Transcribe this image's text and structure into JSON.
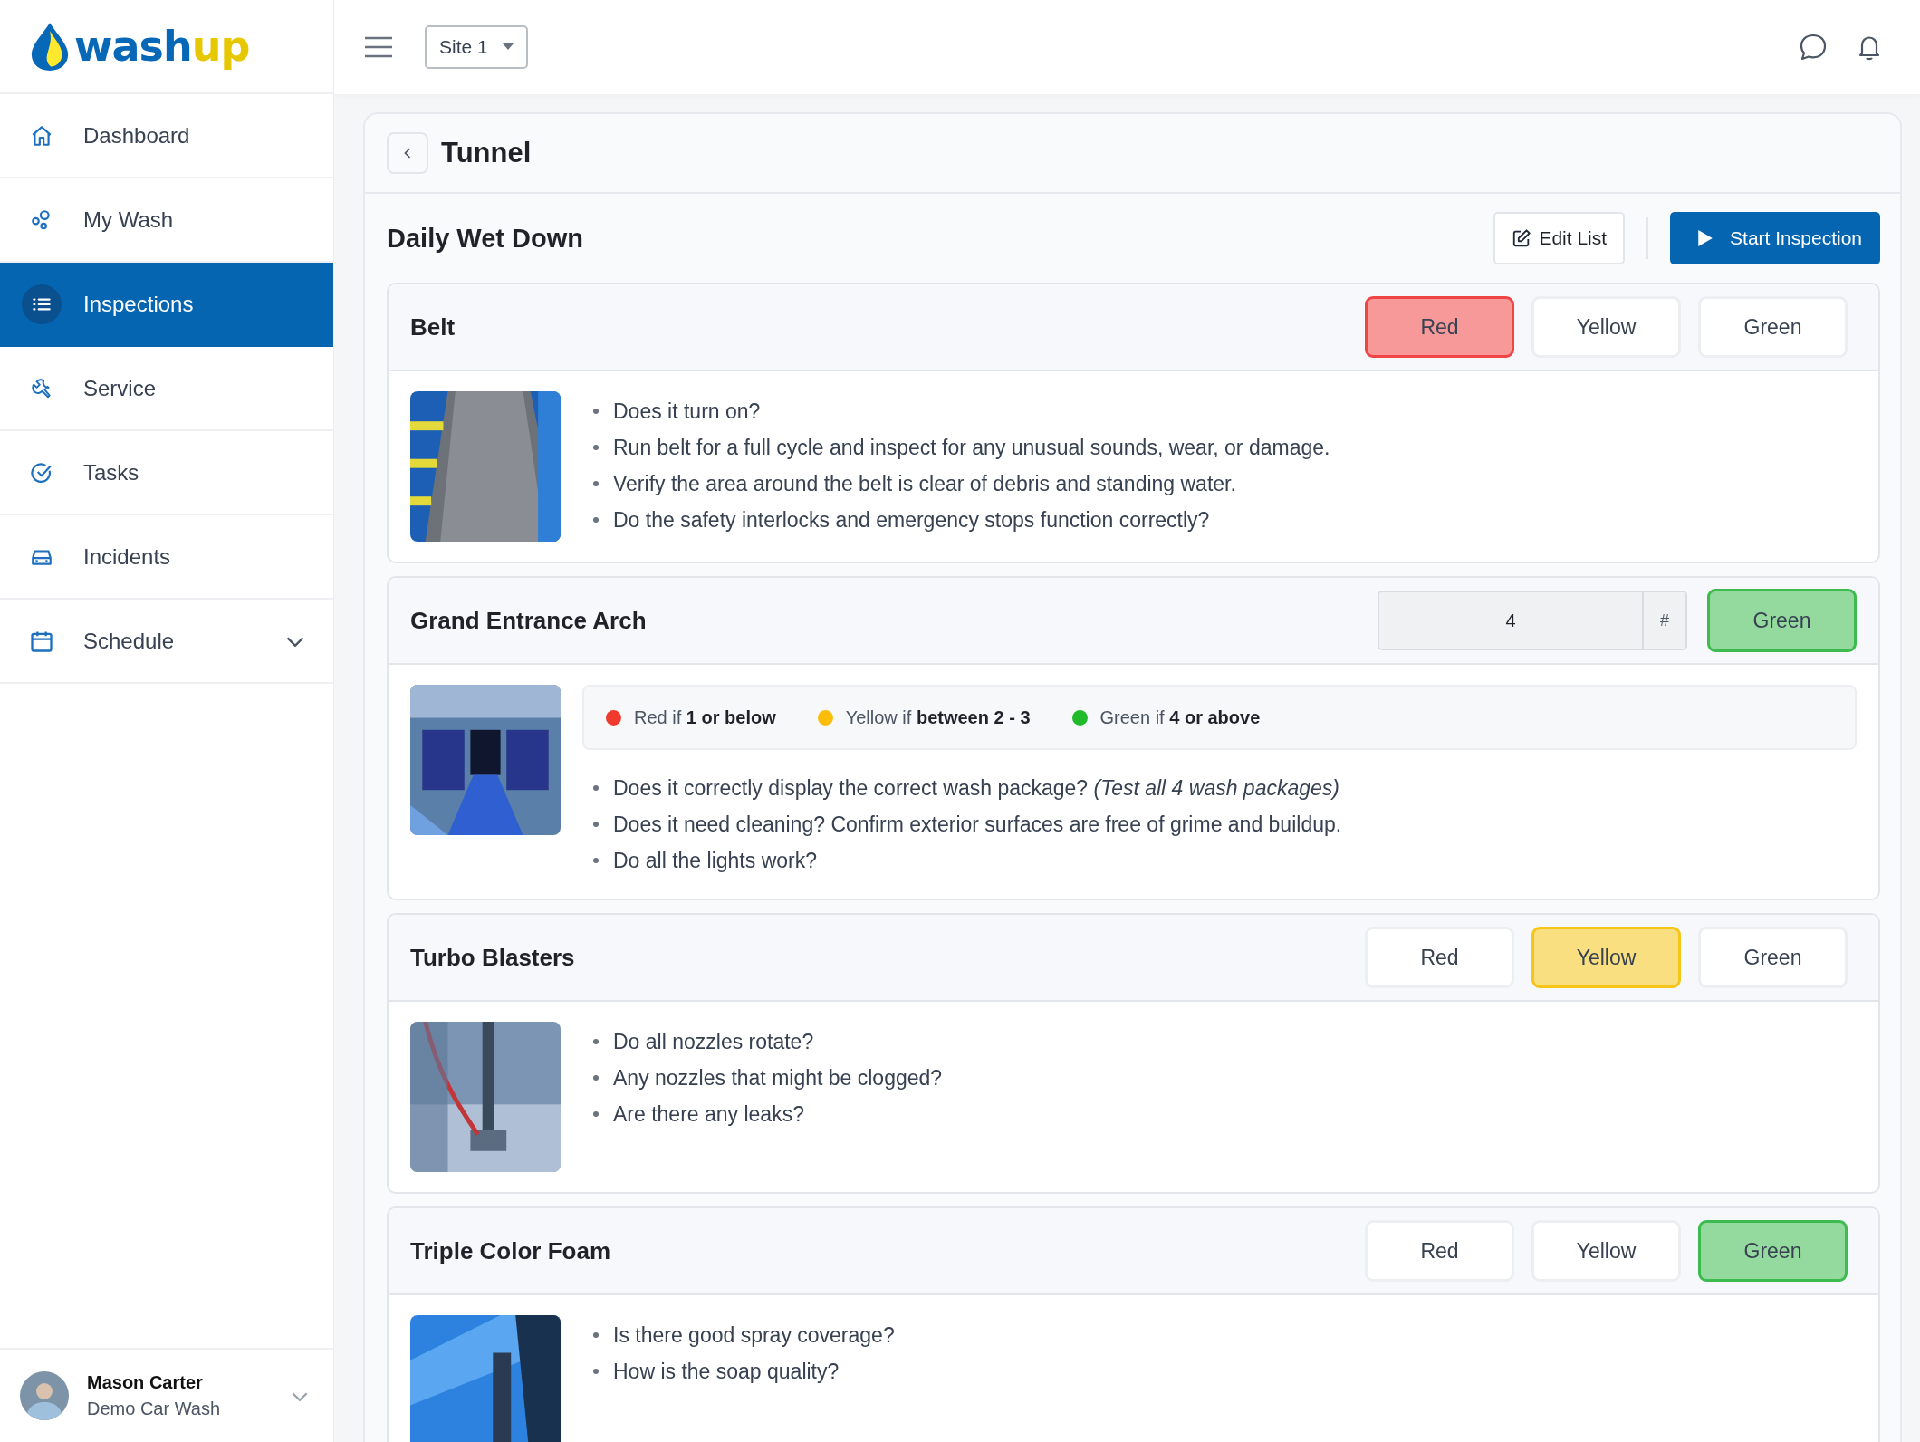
{
  "logo": {
    "primary": "wash",
    "accent": "up"
  },
  "sidebar": {
    "items": [
      {
        "label": "Dashboard",
        "selected": false
      },
      {
        "label": "My Wash",
        "selected": false
      },
      {
        "label": "Inspections",
        "selected": true
      },
      {
        "label": "Service",
        "selected": false
      },
      {
        "label": "Tasks",
        "selected": false
      },
      {
        "label": "Incidents",
        "selected": false
      },
      {
        "label": "Schedule",
        "selected": false,
        "expanded": false
      }
    ],
    "user": {
      "name": "Mason Carter",
      "company": "Demo Car Wash"
    }
  },
  "top_bar": {
    "site_selector": {
      "value": "Site 1"
    }
  },
  "page": {
    "title": "Tunnel",
    "checklist": {
      "title": "Daily Wet Down",
      "edit_button": "Edit List",
      "start_button": "Start Inspection"
    }
  },
  "sections": [
    {
      "kind": "rating",
      "title": "Belt",
      "color": "#f04545",
      "options": [
        {
          "label": "Red",
          "selected": true
        },
        {
          "label": "Yellow",
          "selected": false
        },
        {
          "label": "Green",
          "selected": false
        }
      ],
      "checks": [
        "Does it turn on?",
        "Run belt for a full cycle and inspect for any unusual sounds, wear, or damage.",
        "Verify the area around the belt is clear of debris and standing water.",
        "Do the safety interlocks and emergency stops function correctly?"
      ]
    },
    {
      "kind": "count",
      "title": "Grand Entrance Arch",
      "value": "4",
      "unit": "#",
      "result": {
        "label": "Green",
        "selected": true,
        "color": "#3dbb4f"
      },
      "legend": [
        {
          "text": "Red if **1 or below**",
          "color": "#f03a2e"
        },
        {
          "text": "Yellow if **between 2 - 3**",
          "color": "#fbbd08"
        },
        {
          "text": "Green if **4 or above**",
          "color": "#21ba2a"
        }
      ],
      "checks": [
        "Does it correctly display the correct wash package? *(Test all 4 wash packages)*",
        "Does it need cleaning? Confirm exterior surfaces are free of grime and buildup.",
        "Do all the lights work?"
      ]
    },
    {
      "kind": "rating",
      "title": "Turbo Blasters",
      "color": "#f5c518",
      "options": [
        {
          "label": "Red",
          "selected": false
        },
        {
          "label": "Yellow",
          "selected": true
        },
        {
          "label": "Green",
          "selected": false
        }
      ],
      "checks": [
        "Do all nozzles rotate?",
        "Any nozzles that might be clogged?",
        "Are there any leaks?"
      ]
    },
    {
      "kind": "rating",
      "title": "Triple Color Foam",
      "color": "#3dbb4f",
      "options": [
        {
          "label": "Red",
          "selected": false
        },
        {
          "label": "Yellow",
          "selected": false
        },
        {
          "label": "Green",
          "selected": true
        }
      ],
      "checks": [
        "Is there good spray coverage?",
        "How is the soap quality?"
      ]
    }
  ]
}
